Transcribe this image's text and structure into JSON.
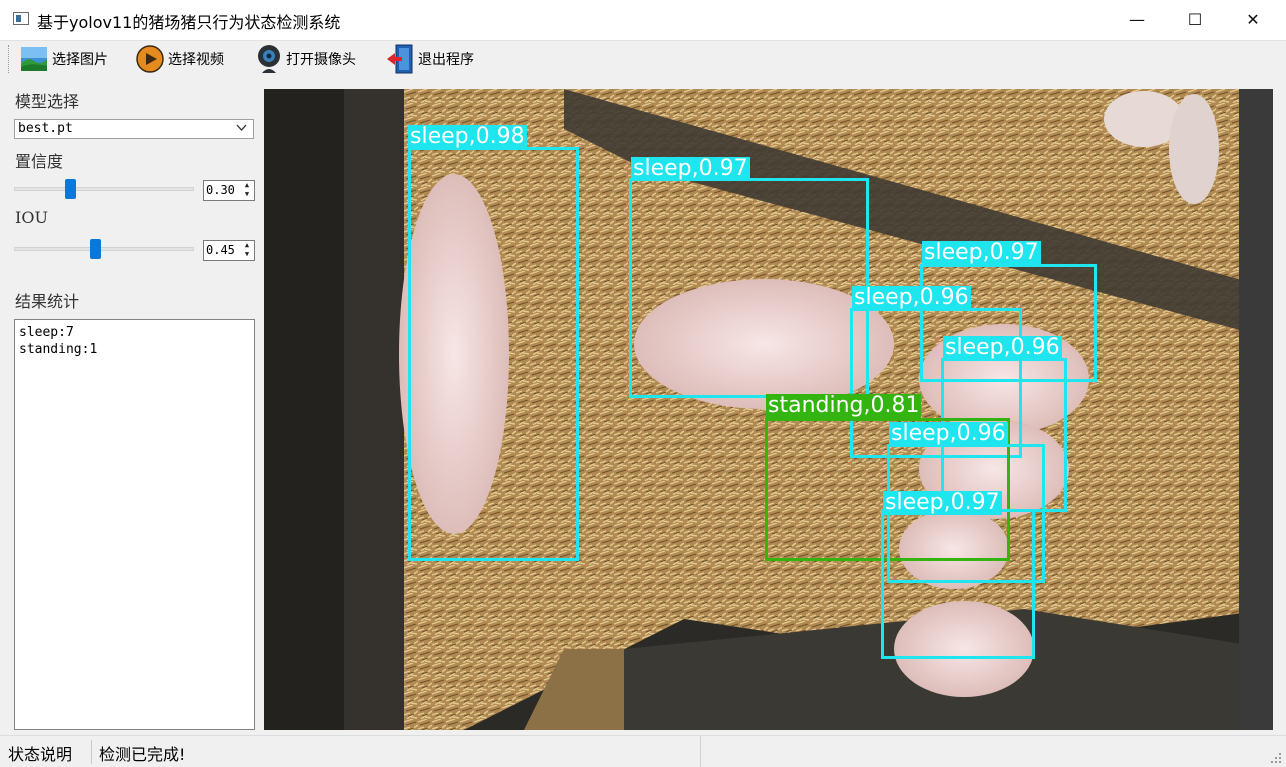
{
  "window": {
    "title": "基于yolov11的猪场猪只行为状态检测系统",
    "minimize_glyph": "—",
    "maximize_glyph": "☐",
    "close_glyph": "✕"
  },
  "toolbar": {
    "select_image": "选择图片",
    "select_video": "选择视频",
    "open_camera": "打开摄像头",
    "exit_program": "退出程序"
  },
  "sidebar": {
    "model_label": "模型选择",
    "model_value": "best.pt",
    "conf_label": "置信度",
    "conf_value": "0.30",
    "conf_level": 0.3,
    "iou_label": "IOU",
    "iou_value": "0.45",
    "iou_level": 0.45,
    "results_label": "结果统计",
    "results": [
      "sleep:7",
      "standing:1"
    ]
  },
  "detections": [
    {
      "label": "sleep,0.98",
      "class": "sleep",
      "conf": 0.98
    },
    {
      "label": "sleep,0.97",
      "class": "sleep",
      "conf": 0.97
    },
    {
      "label": "sleep,0.97",
      "class": "sleep",
      "conf": 0.97
    },
    {
      "label": "sleep,0.96",
      "class": "sleep",
      "conf": 0.96
    },
    {
      "label": "sleep,0.96",
      "class": "sleep",
      "conf": 0.96
    },
    {
      "label": "standing,0.81",
      "class": "standing",
      "conf": 0.81
    },
    {
      "label": "sleep,0.96",
      "class": "sleep",
      "conf": 0.96
    },
    {
      "label": "sleep,0.97",
      "class": "sleep",
      "conf": 0.97
    }
  ],
  "colors": {
    "sleep": "#1fe6ee",
    "standing": "#33b411",
    "slider_accent": "#0a78d7"
  },
  "statusbar": {
    "label": "状态说明",
    "message": "检测已完成!"
  }
}
